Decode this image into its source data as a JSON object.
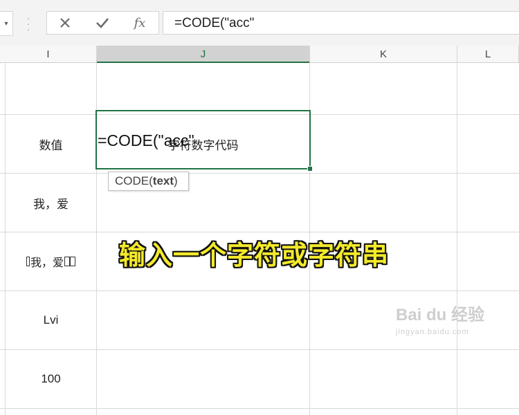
{
  "formula_bar": {
    "cancel_icon": "close-icon",
    "enter_icon": "check-icon",
    "fx_label": "fx",
    "formula": "=CODE(\"acc\""
  },
  "columns": [
    "I",
    "J",
    "K",
    "L"
  ],
  "active_column": "J",
  "cells": {
    "I_header": "数值",
    "J_header": "字符数字代码",
    "I_r2": "我，爱",
    "I_r3": "\u0000我，爱\u0000\u0000",
    "I_r3_display": "我，爱",
    "I_r4": "Lvi",
    "I_r5": "100"
  },
  "active_cell": {
    "formula": "=CODE(\"acc\""
  },
  "tooltip": {
    "func": "CODE(",
    "arg": "text",
    "close": ")"
  },
  "overlay_caption": "输入一个字符或字符串",
  "watermark": {
    "logo": "Bai du 经验",
    "url": "jingyan.baidu.com"
  }
}
